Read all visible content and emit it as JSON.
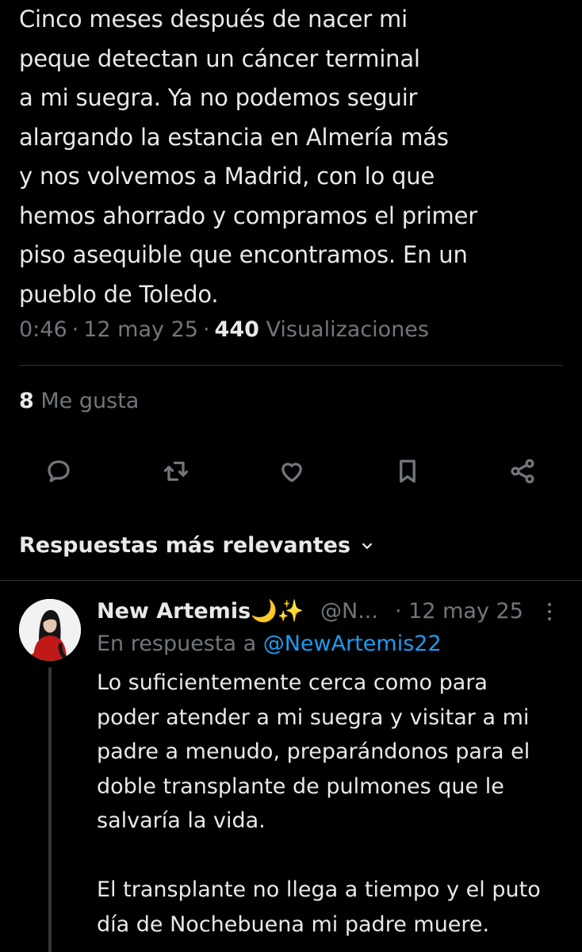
{
  "tweet": {
    "text_lines": [
      "Cinco meses después de nacer mi",
      "peque detectan un cáncer terminal",
      "a mi suegra. Ya no podemos seguir",
      "alargando la estancia en Almería más",
      "y nos volvemos a Madrid, con lo que",
      "hemos ahorrado y compramos el primer",
      "piso asequible que encontramos. En un",
      "pueblo de Toledo."
    ],
    "time": "0:46",
    "date": "12 may 25",
    "views_count": "440",
    "views_label": "Visualizaciones",
    "likes_count": "8",
    "likes_label": "Me gusta"
  },
  "actions": [
    {
      "name": "reply",
      "icon": "reply-icon"
    },
    {
      "name": "retweet",
      "icon": "retweet-icon"
    },
    {
      "name": "like",
      "icon": "heart-icon"
    },
    {
      "name": "bookmark",
      "icon": "bookmark-icon"
    },
    {
      "name": "share",
      "icon": "share-icon"
    }
  ],
  "replies_sort": {
    "label": "Respuestas más relevantes"
  },
  "reply": {
    "author_name": "New Artemis🌙✨",
    "handle": "@N...",
    "date": "· 12 may 25",
    "in_reply_prefix": "En respuesta a",
    "in_reply_mention": "@NewArtemis22",
    "paragraph1_lines": [
      "Lo suficientemente cerca como para",
      "poder atender a mi suegra y visitar a mi",
      "padre a menudo, preparándonos para el",
      "doble transplante de pulmones que le",
      "salvaría la vida."
    ],
    "paragraph2_lines": [
      "El transplante no llega a tiempo y el puto",
      "día de Nochebuena mi padre muere."
    ]
  },
  "colors": {
    "background": "#000000",
    "text": "#e7e9ea",
    "secondary": "#71767b",
    "divider": "#2f3336",
    "link": "#1d9bf0"
  }
}
